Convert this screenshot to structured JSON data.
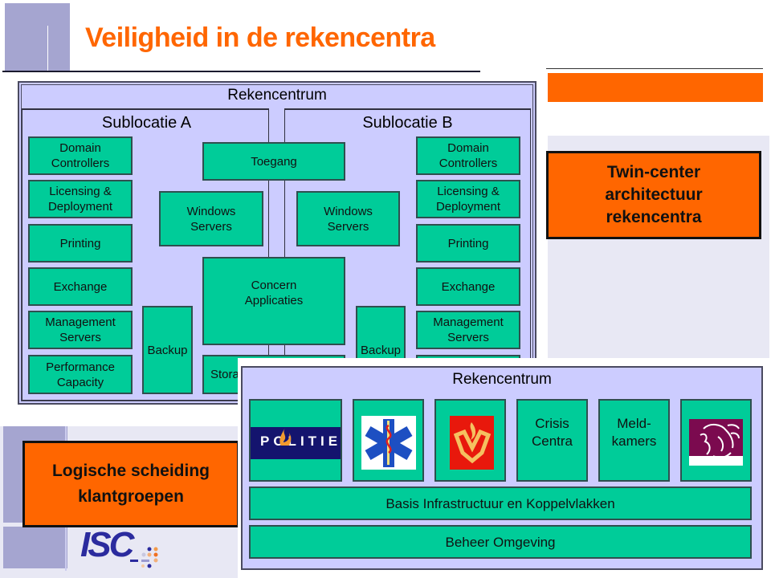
{
  "slide": {
    "title": "Veiligheid in de rekencentra",
    "accent_color": "#ff6600",
    "panel_color": "#ccccff",
    "box_color": "#00cc99"
  },
  "top_diagram": {
    "title": "Rekencentrum",
    "sublocatie_a": {
      "title": "Sublocatie A",
      "left_column": [
        "Domain\nControllers",
        "Licensing &\nDeployment",
        "Printing",
        "Exchange",
        "Management\nServers",
        "Performance\nCapacity"
      ],
      "windows_servers": "Windows\nServers",
      "backup": "Backup"
    },
    "shared": {
      "toegang": "Toegang",
      "concern_applicaties": "Concern\nApplicaties",
      "storage": "Storage"
    },
    "sublocatie_b": {
      "title": "Sublocatie B",
      "right_column": [
        "Domain\nControllers",
        "Licensing &\nDeployment",
        "Printing",
        "Exchange",
        "Management\nServers"
      ],
      "windows_servers": "Windows\nServers",
      "backup": "Backup"
    }
  },
  "callouts": {
    "twin_center": "Twin-center\narchitectuur\nrekencentra",
    "logische_scheiding": "Logische scheiding\nklantgroepen"
  },
  "bottom_diagram": {
    "title": "Rekencentrum",
    "tiles": [
      {
        "type": "logo",
        "icon": "politie-logo-icon",
        "text": "POLITIE"
      },
      {
        "type": "logo",
        "icon": "star-of-life-icon"
      },
      {
        "type": "logo",
        "icon": "brandweer-logo-icon"
      },
      {
        "type": "text",
        "text": "Crisis\nCentra"
      },
      {
        "type": "text",
        "text": "Meld-\nkamers"
      },
      {
        "type": "logo",
        "icon": "rijksoverheid-lion-icon"
      }
    ],
    "basis": "Basis Infrastructuur en Koppelvlakken",
    "beheer": "Beheer Omgeving"
  },
  "footer": {
    "logo_text": "ISC"
  }
}
